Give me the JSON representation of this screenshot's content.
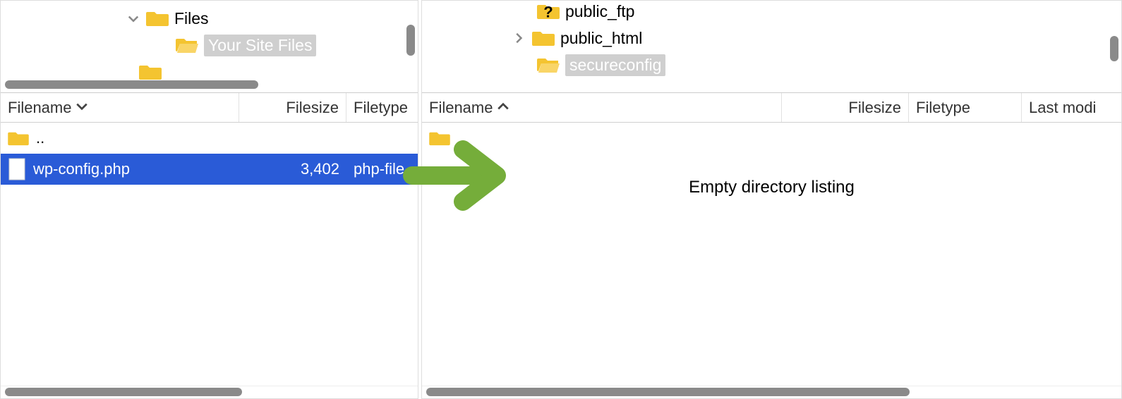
{
  "left": {
    "tree": [
      {
        "indent": 170,
        "chevron": "down",
        "label": "Files"
      },
      {
        "indent": 240,
        "chevron": "",
        "label": "Your Site Files",
        "selected": true
      }
    ],
    "columns": {
      "filename": "Filename",
      "filesize": "Filesize",
      "filetype": "Filetype",
      "sort_dir": "down"
    },
    "rows": [
      {
        "type": "parent",
        "name": ".."
      },
      {
        "type": "file",
        "name": "wp-config.php",
        "size": "3,402",
        "ftype": "php-file",
        "selected": true
      }
    ]
  },
  "right": {
    "tree": [
      {
        "indent": 155,
        "chevron": "",
        "kind": "question",
        "label": "public_ftp"
      },
      {
        "indent": 120,
        "chevron": "right",
        "kind": "folder",
        "label": "public_html"
      },
      {
        "indent": 155,
        "chevron": "",
        "kind": "folder-open",
        "label": "secureconfig",
        "selected": true
      }
    ],
    "columns": {
      "filename": "Filename",
      "filesize": "Filesize",
      "filetype": "Filetype",
      "lastmod": "Last modi",
      "sort_dir": "up"
    },
    "rows": [
      {
        "type": "parent",
        "name": ".."
      }
    ],
    "empty_message": "Empty directory listing"
  }
}
